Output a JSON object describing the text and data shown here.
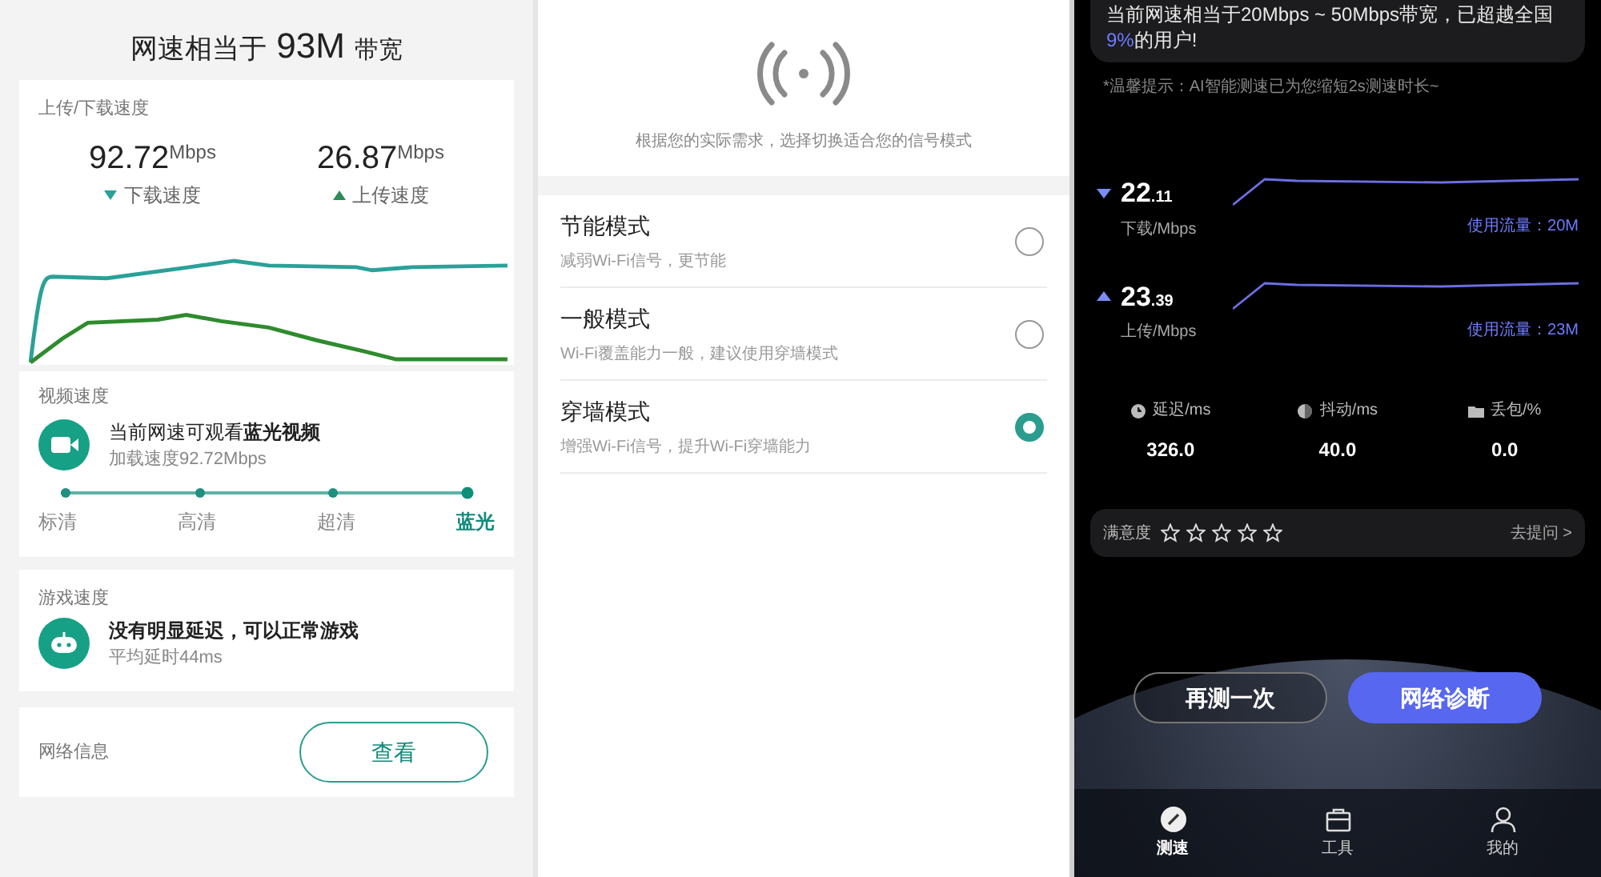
{
  "speed_panel": {
    "headline": {
      "prefix": "网速相当于",
      "value": "93M",
      "suffix": "带宽"
    },
    "speed_card": {
      "label": "上传/下载速度",
      "readings": [
        {
          "kind": "download",
          "value": "92.72",
          "unit": "Mbps",
          "caption": "下载速度"
        },
        {
          "kind": "upload",
          "value": "26.87",
          "unit": "Mbps",
          "caption": "上传速度"
        }
      ]
    },
    "video_card": {
      "label": "视频速度",
      "title": "当前网速可观看**蓝光视频**",
      "subtitle": "加载速度92.72Mbps",
      "levels": [
        {
          "label": "标清",
          "selected": false
        },
        {
          "label": "高清",
          "selected": false
        },
        {
          "label": "超清",
          "selected": false
        },
        {
          "label": "蓝光",
          "selected": true
        }
      ]
    },
    "game_card": {
      "label": "游戏速度",
      "title": "没有明显延迟，可以正常游戏",
      "subtitle": "平均延时44ms"
    },
    "network_card": {
      "label": "网络信息",
      "button": "查看"
    }
  },
  "signal_panel": {
    "caption": "根据您的实际需求，选择切换适合您的信号模式",
    "modes": [
      {
        "title": "节能模式",
        "description": "减弱Wi-Fi信号，更节能",
        "selected": false
      },
      {
        "title": "一般模式",
        "description": "Wi-Fi覆盖能力一般，建议使用穿墙模式",
        "selected": false
      },
      {
        "title": "穿墙模式",
        "description": "增强Wi-Fi信号，提升Wi-Fi穿墙能力",
        "selected": true
      }
    ]
  },
  "result_panel": {
    "summary": {
      "before": "当前网速相当于20Mbps ~ 50Mbps带宽，已超越全国",
      "highlight": "9%",
      "after": "的用户!"
    },
    "tip": "*温馨提示：AI智能测速已为您缩短2s测速时长~",
    "speeds": [
      {
        "kind": "download",
        "whole": "22",
        "fraction": ".11",
        "unit": "下载/Mbps",
        "usage": "使用流量：20M"
      },
      {
        "kind": "upload",
        "whole": "23",
        "fraction": ".39",
        "unit": "上传/Mbps",
        "usage": "使用流量：23M"
      }
    ],
    "stats": [
      {
        "kind": "latency",
        "label": "延迟/ms",
        "value": "326.0"
      },
      {
        "kind": "jitter",
        "label": "抖动/ms",
        "value": "40.0"
      },
      {
        "kind": "loss",
        "label": "丢包/%",
        "value": "0.0"
      }
    ],
    "satisfaction": {
      "label": "满意度",
      "stars": 0,
      "link": "去提问 >"
    },
    "buttons": [
      {
        "kind": "secondary",
        "label": "再测一次"
      },
      {
        "kind": "primary",
        "label": "网络诊断"
      }
    ],
    "nav": [
      {
        "kind": "speed",
        "label": "测速",
        "selected": true
      },
      {
        "kind": "tools",
        "label": "工具",
        "selected": false
      },
      {
        "kind": "profile",
        "label": "我的",
        "selected": false
      }
    ]
  }
}
